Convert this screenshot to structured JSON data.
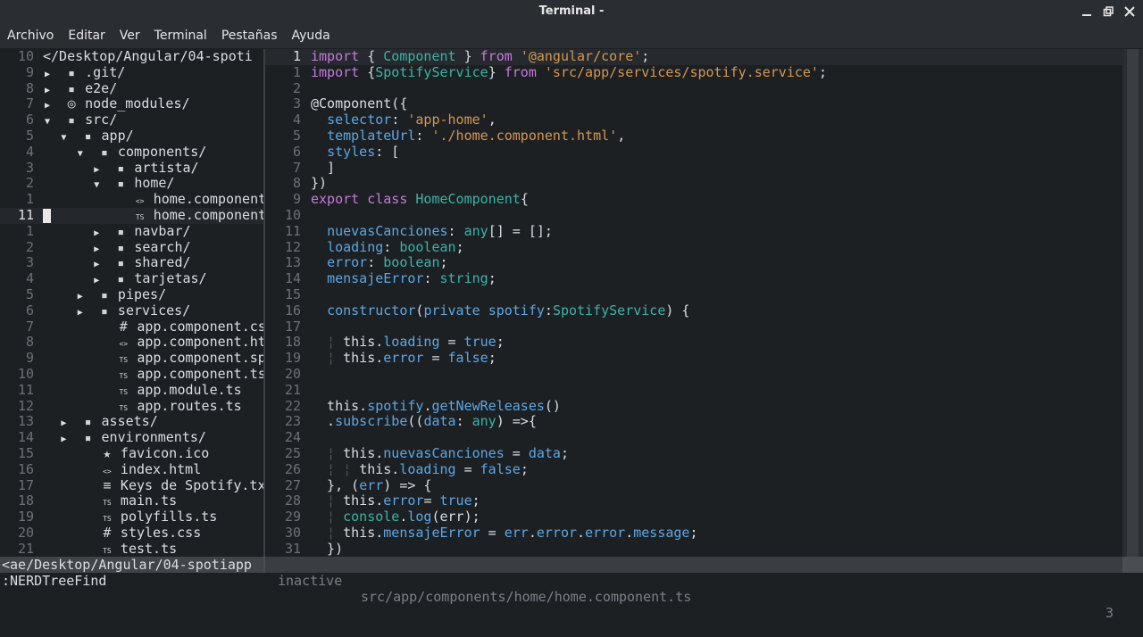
{
  "window": {
    "title": "Terminal -",
    "controls": [
      "minimize-icon",
      "restore-icon",
      "close-icon"
    ]
  },
  "menu": [
    "Archivo",
    "Editar",
    "Ver",
    "Terminal",
    "Pestañas",
    "Ayuda"
  ],
  "tree": {
    "lines": [
      {
        "num": "10",
        "indent": 0,
        "arrow": "",
        "icon": "",
        "name": "</Desktop/Angular/04-spoti"
      },
      {
        "num": "9",
        "indent": 0,
        "arrow": "▶",
        "icon": "▪",
        "name": ".git/"
      },
      {
        "num": "8",
        "indent": 0,
        "arrow": "▶",
        "icon": "▪",
        "name": "e2e/"
      },
      {
        "num": "7",
        "indent": 0,
        "arrow": "▶",
        "icon": "◎",
        "name": "node_modules/"
      },
      {
        "num": "6",
        "indent": 0,
        "arrow": "▼",
        "icon": "▪",
        "name": "src/"
      },
      {
        "num": "5",
        "indent": 1,
        "arrow": "▼",
        "icon": "▪",
        "name": "app/"
      },
      {
        "num": "4",
        "indent": 2,
        "arrow": "▼",
        "icon": "▪",
        "name": "components/"
      },
      {
        "num": "3",
        "indent": 3,
        "arrow": "▶",
        "icon": "▪",
        "name": "artista/"
      },
      {
        "num": "2",
        "indent": 3,
        "arrow": "▼",
        "icon": "▪",
        "name": "home/"
      },
      {
        "num": "1",
        "indent": 4,
        "arrow": "",
        "icon": "<>",
        "name": "home.component.ht"
      },
      {
        "num": "11",
        "indent": 4,
        "arrow": "",
        "icon": "TS",
        "name": "home.component.ts",
        "current": true
      },
      {
        "num": "1",
        "indent": 3,
        "arrow": "▶",
        "icon": "▪",
        "name": "navbar/"
      },
      {
        "num": "2",
        "indent": 3,
        "arrow": "▶",
        "icon": "▪",
        "name": "search/"
      },
      {
        "num": "3",
        "indent": 3,
        "arrow": "▶",
        "icon": "▪",
        "name": "shared/"
      },
      {
        "num": "4",
        "indent": 3,
        "arrow": "▶",
        "icon": "▪",
        "name": "tarjetas/"
      },
      {
        "num": "5",
        "indent": 2,
        "arrow": "▶",
        "icon": "▪",
        "name": "pipes/"
      },
      {
        "num": "6",
        "indent": 2,
        "arrow": "▶",
        "icon": "▪",
        "name": "services/"
      },
      {
        "num": "7",
        "indent": 3,
        "arrow": "",
        "icon": "#",
        "name": "app.component.css"
      },
      {
        "num": "8",
        "indent": 3,
        "arrow": "",
        "icon": "<>",
        "name": "app.component.html"
      },
      {
        "num": "9",
        "indent": 3,
        "arrow": "",
        "icon": "TS",
        "name": "app.component.spec."
      },
      {
        "num": "10",
        "indent": 3,
        "arrow": "",
        "icon": "TS",
        "name": "app.component.ts"
      },
      {
        "num": "11",
        "indent": 3,
        "arrow": "",
        "icon": "TS",
        "name": "app.module.ts"
      },
      {
        "num": "12",
        "indent": 3,
        "arrow": "",
        "icon": "TS",
        "name": "app.routes.ts"
      },
      {
        "num": "13",
        "indent": 1,
        "arrow": "▶",
        "icon": "▪",
        "name": "assets/"
      },
      {
        "num": "14",
        "indent": 1,
        "arrow": "▶",
        "icon": "▪",
        "name": "environments/"
      },
      {
        "num": "15",
        "indent": 2,
        "arrow": "",
        "icon": "★",
        "name": "favicon.ico"
      },
      {
        "num": "16",
        "indent": 2,
        "arrow": "",
        "icon": "<>",
        "name": "index.html"
      },
      {
        "num": "17",
        "indent": 2,
        "arrow": "",
        "icon": "≡",
        "name": "Keys de Spotify.txt"
      },
      {
        "num": "18",
        "indent": 2,
        "arrow": "",
        "icon": "TS",
        "name": "main.ts"
      },
      {
        "num": "19",
        "indent": 2,
        "arrow": "",
        "icon": "TS",
        "name": "polyfills.ts"
      },
      {
        "num": "20",
        "indent": 2,
        "arrow": "",
        "icon": "#",
        "name": "styles.css"
      },
      {
        "num": "21",
        "indent": 2,
        "arrow": "",
        "icon": "TS",
        "name": "test.ts"
      }
    ]
  },
  "editor": {
    "lines": [
      {
        "num": "1",
        "current": true,
        "tokens": [
          [
            "kw",
            "import"
          ],
          [
            "pl",
            " { "
          ],
          [
            "typ",
            "Component"
          ],
          [
            "pl",
            " } "
          ],
          [
            "kw",
            "from"
          ],
          [
            "pl",
            " "
          ],
          [
            "str",
            "'@angular/core'"
          ],
          [
            "pl",
            ";"
          ]
        ]
      },
      {
        "num": "1",
        "tokens": [
          [
            "kw",
            "import"
          ],
          [
            "pl",
            " {"
          ],
          [
            "typ",
            "SpotifyService"
          ],
          [
            "pl",
            "} "
          ],
          [
            "kw",
            "from"
          ],
          [
            "pl",
            " "
          ],
          [
            "str",
            "'src/app/services/spotify.service'"
          ],
          [
            "pl",
            ";"
          ]
        ]
      },
      {
        "num": "2",
        "tokens": []
      },
      {
        "num": "3",
        "tokens": [
          [
            "pl",
            "@Component({"
          ]
        ]
      },
      {
        "num": "4",
        "tokens": [
          [
            "pl",
            "  "
          ],
          [
            "fn",
            "selector"
          ],
          [
            "pl",
            ": "
          ],
          [
            "str",
            "'app-home'"
          ],
          [
            "pl",
            ","
          ]
        ]
      },
      {
        "num": "5",
        "tokens": [
          [
            "pl",
            "  "
          ],
          [
            "fn",
            "templateUrl"
          ],
          [
            "pl",
            ": "
          ],
          [
            "str",
            "'./home.component.html'"
          ],
          [
            "pl",
            ","
          ]
        ]
      },
      {
        "num": "6",
        "tokens": [
          [
            "pl",
            "  "
          ],
          [
            "fn",
            "styles"
          ],
          [
            "pl",
            ": ["
          ]
        ]
      },
      {
        "num": "7",
        "tokens": [
          [
            "pl",
            "  ]"
          ]
        ]
      },
      {
        "num": "8",
        "tokens": [
          [
            "pl",
            "})"
          ]
        ]
      },
      {
        "num": "9",
        "tokens": [
          [
            "kw",
            "export"
          ],
          [
            "pl",
            " "
          ],
          [
            "kw",
            "class"
          ],
          [
            "pl",
            " "
          ],
          [
            "typ",
            "HomeComponent"
          ],
          [
            "pl",
            "{"
          ]
        ]
      },
      {
        "num": "10",
        "tokens": []
      },
      {
        "num": "11",
        "tokens": [
          [
            "pl",
            "  "
          ],
          [
            "fn",
            "nuevasCanciones"
          ],
          [
            "pl",
            ": "
          ],
          [
            "typ",
            "any"
          ],
          [
            "pl",
            "[] = [];"
          ]
        ]
      },
      {
        "num": "12",
        "tokens": [
          [
            "pl",
            "  "
          ],
          [
            "fn",
            "loading"
          ],
          [
            "pl",
            ": "
          ],
          [
            "typ",
            "boolean"
          ],
          [
            "pl",
            ";"
          ]
        ]
      },
      {
        "num": "13",
        "tokens": [
          [
            "pl",
            "  "
          ],
          [
            "fn",
            "error"
          ],
          [
            "pl",
            ": "
          ],
          [
            "typ",
            "boolean"
          ],
          [
            "pl",
            ";"
          ]
        ]
      },
      {
        "num": "14",
        "tokens": [
          [
            "pl",
            "  "
          ],
          [
            "fn",
            "mensajeError"
          ],
          [
            "pl",
            ": "
          ],
          [
            "typ",
            "string"
          ],
          [
            "pl",
            ";"
          ]
        ]
      },
      {
        "num": "15",
        "tokens": []
      },
      {
        "num": "16",
        "tokens": [
          [
            "pl",
            "  "
          ],
          [
            "fn",
            "constructor"
          ],
          [
            "pl",
            "("
          ],
          [
            "fn",
            "private"
          ],
          [
            "pl",
            " "
          ],
          [
            "fn",
            "spotify"
          ],
          [
            "pl",
            ":"
          ],
          [
            "typ",
            "SpotifyService"
          ],
          [
            "pl",
            ") {"
          ]
        ]
      },
      {
        "num": "17",
        "tokens": []
      },
      {
        "num": "18",
        "tokens": [
          [
            "guide",
            "  ¦ "
          ],
          [
            "pl",
            "this."
          ],
          [
            "fn",
            "loading"
          ],
          [
            "pl",
            " = "
          ],
          [
            "th",
            "true"
          ],
          [
            "pl",
            ";"
          ]
        ]
      },
      {
        "num": "19",
        "tokens": [
          [
            "guide",
            "  ¦ "
          ],
          [
            "pl",
            "this."
          ],
          [
            "fn",
            "error"
          ],
          [
            "pl",
            " = "
          ],
          [
            "th",
            "false"
          ],
          [
            "pl",
            ";"
          ]
        ]
      },
      {
        "num": "20",
        "tokens": []
      },
      {
        "num": "21",
        "tokens": []
      },
      {
        "num": "22",
        "tokens": [
          [
            "pl",
            "  this."
          ],
          [
            "fn",
            "spotify"
          ],
          [
            "pl",
            "."
          ],
          [
            "fn",
            "getNewReleases"
          ],
          [
            "pl",
            "()"
          ]
        ]
      },
      {
        "num": "23",
        "tokens": [
          [
            "pl",
            "  ."
          ],
          [
            "fn",
            "subscribe"
          ],
          [
            "pl",
            "(("
          ],
          [
            "fn",
            "data"
          ],
          [
            "pl",
            ": "
          ],
          [
            "typ",
            "any"
          ],
          [
            "pl",
            ") =>{"
          ]
        ]
      },
      {
        "num": "24",
        "tokens": []
      },
      {
        "num": "25",
        "tokens": [
          [
            "guide",
            "  ¦ "
          ],
          [
            "pl",
            "this."
          ],
          [
            "fn",
            "nuevasCanciones"
          ],
          [
            "pl",
            " = "
          ],
          [
            "fn",
            "data"
          ],
          [
            "pl",
            ";"
          ]
        ]
      },
      {
        "num": "26",
        "tokens": [
          [
            "guide",
            "  ¦ ¦ "
          ],
          [
            "pl",
            "this."
          ],
          [
            "fn",
            "loading"
          ],
          [
            "pl",
            " = "
          ],
          [
            "th",
            "false"
          ],
          [
            "pl",
            ";"
          ]
        ]
      },
      {
        "num": "27",
        "tokens": [
          [
            "pl",
            "  }, ("
          ],
          [
            "fn",
            "err"
          ],
          [
            "pl",
            ") => {"
          ]
        ]
      },
      {
        "num": "28",
        "tokens": [
          [
            "guide",
            "  ¦ "
          ],
          [
            "pl",
            "this."
          ],
          [
            "fn",
            "error"
          ],
          [
            "pl",
            "= "
          ],
          [
            "th",
            "true"
          ],
          [
            "pl",
            ";"
          ]
        ]
      },
      {
        "num": "29",
        "tokens": [
          [
            "guide",
            "  ¦ "
          ],
          [
            "typ",
            "console"
          ],
          [
            "pl",
            "."
          ],
          [
            "fn",
            "log"
          ],
          [
            "pl",
            "(err);"
          ]
        ]
      },
      {
        "num": "30",
        "tokens": [
          [
            "guide",
            "  ¦ "
          ],
          [
            "pl",
            "this."
          ],
          [
            "fn",
            "mensajeError"
          ],
          [
            "pl",
            " = "
          ],
          [
            "fn",
            "err"
          ],
          [
            "pl",
            "."
          ],
          [
            "fn",
            "error"
          ],
          [
            "pl",
            "."
          ],
          [
            "fn",
            "error"
          ],
          [
            "pl",
            "."
          ],
          [
            "fn",
            "message"
          ],
          [
            "pl",
            ";"
          ]
        ]
      },
      {
        "num": "31",
        "tokens": [
          [
            "pl",
            "  })"
          ]
        ]
      }
    ]
  },
  "status": {
    "tree_path": "<ae/Desktop/Angular/04-spotiapp",
    "mode": "inactive",
    "file_path": "src/app/components/home/home.component.ts",
    "line_num": "3"
  },
  "cmdline": ":NERDTreeFind",
  "colors": {
    "background": "#1d2023",
    "keyword": "#c678dd",
    "string": "#d4974f",
    "type": "#39b4a6",
    "identifier": "#5aa7e6"
  }
}
